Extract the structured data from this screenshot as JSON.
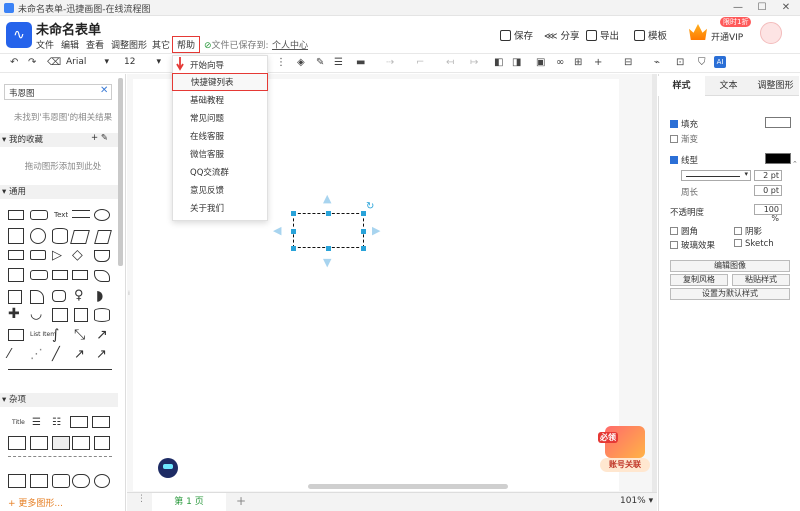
{
  "window": {
    "title": "未命名表单-迅捷画图-在线流程图"
  },
  "header": {
    "doc_title": "未命名表单",
    "menus": [
      "文件",
      "编辑",
      "查看",
      "调整图形",
      "其它",
      "帮助"
    ],
    "saved_text": "文件已保存到:",
    "saved_link": "个人中心",
    "actions": {
      "save": "保存",
      "share": "分享",
      "export": "导出",
      "template": "模板"
    },
    "vip_label": "开通VIP",
    "vip_badge": "限时1折"
  },
  "toolbar": {
    "font_name": "Arial",
    "font_size": "12"
  },
  "help_menu": {
    "items": [
      "开始向导",
      "快捷键列表",
      "基础教程",
      "常见问题",
      "在线客服",
      "微信客服",
      "QQ交流群",
      "意见反馈",
      "关于我们"
    ],
    "highlighted_index": 1
  },
  "left_panel": {
    "search_value": "韦恩图",
    "no_result": "未找到'韦恩图'的相关结果",
    "favorites_label": "我的收藏",
    "favorites_hint": "拖动图形添加到此处",
    "general_label": "通用",
    "misc_label": "杂项",
    "more_shapes": "+ 更多图形...",
    "shape_text_label": "Text",
    "shape_title_label": "Title",
    "shape_list_label": "List Item"
  },
  "right_panel": {
    "tabs": [
      "样式",
      "文本",
      "调整图形"
    ],
    "active_tab": 0,
    "fill_label": "填充",
    "gradient_label": "渐变",
    "line_label": "线型",
    "line_width": "2 pt",
    "perimeter_label": "周长",
    "perimeter_value": "0 pt",
    "opacity_label": "不透明度",
    "opacity_value": "100 %",
    "rounded_label": "圆角",
    "shadow_label": "阴影",
    "glass_label": "玻璃效果",
    "sketch_label": "Sketch",
    "edit_image_btn": "编辑图像",
    "copy_style_btn": "复制风格",
    "paste_style_btn": "粘贴样式",
    "default_style_btn": "设置为默认样式",
    "colors": {
      "fill": "#ffffff",
      "line": "#000000"
    }
  },
  "bottom": {
    "page_tab": "第 1 页",
    "zoom": "101%"
  },
  "promo": {
    "label": "账号关联",
    "tag": "必领"
  }
}
